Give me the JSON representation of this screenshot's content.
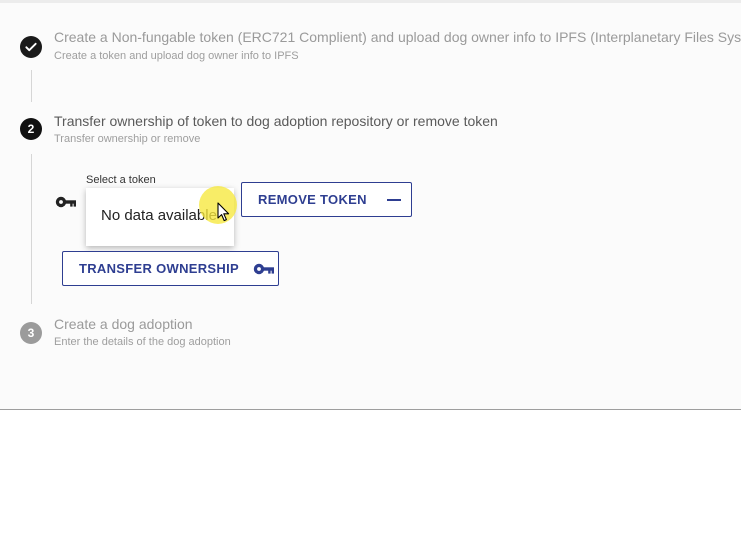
{
  "steps": [
    {
      "number": "1",
      "title": "Create a Non-fungable token (ERC721 Complient) and upload dog owner info to IPFS (Interplanetary Files System)",
      "subtitle": "Create a token and upload dog owner info to IPFS",
      "state": "completed",
      "icon": "checkmark-icon"
    },
    {
      "number": "2",
      "title": "Transfer ownership of token to dog adoption repository or remove token",
      "subtitle": "Transfer ownership or remove",
      "state": "active"
    },
    {
      "number": "3",
      "title": "Create a dog adoption",
      "subtitle": "Enter the details of the dog adoption",
      "state": "pending"
    }
  ],
  "token_select": {
    "label": "Select a token",
    "prefix_icon": "key-icon",
    "dropdown_text": "No data available"
  },
  "buttons": {
    "remove_token": {
      "label": "REMOVE TOKEN",
      "icon": "minus-icon"
    },
    "transfer_ownership": {
      "label": "TRANSFER OWNERSHIP",
      "icon": "key-icon"
    }
  },
  "colors": {
    "accent": "#2e3e91",
    "completed": "#1a1a1a",
    "pending": "#9b9b9b",
    "cursor_highlight": "#f6e83c"
  }
}
